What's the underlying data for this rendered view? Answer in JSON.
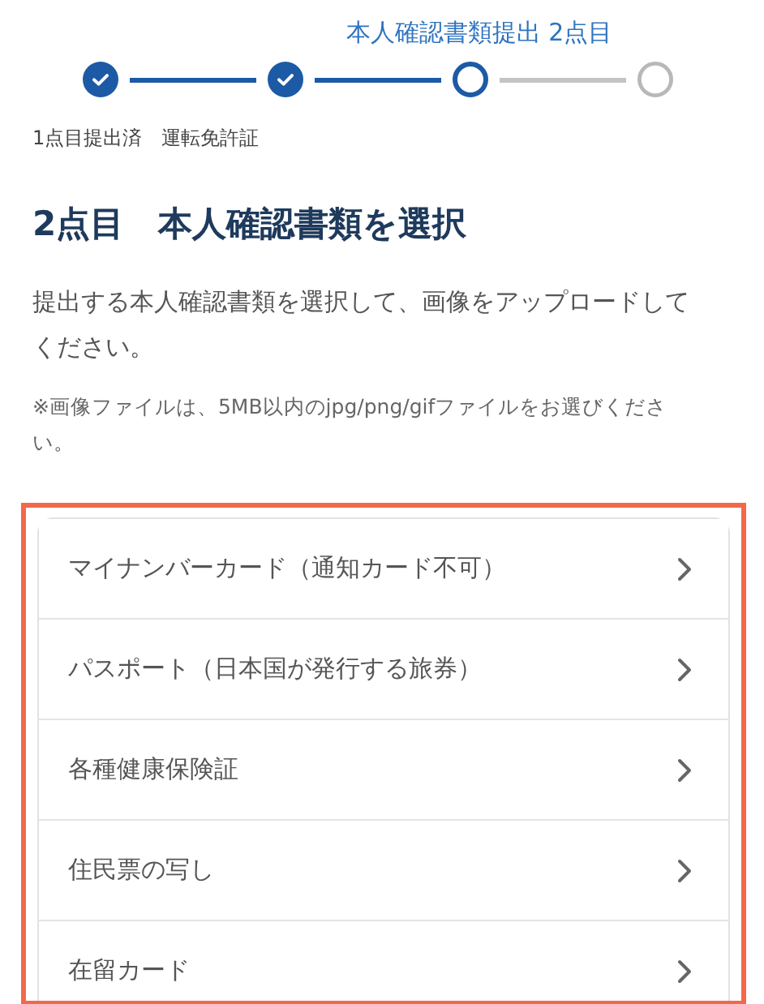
{
  "stepper": {
    "current_label": "本人確認書類提出 2点目",
    "steps": [
      {
        "kind": "done"
      },
      {
        "kind": "done"
      },
      {
        "kind": "current"
      },
      {
        "kind": "todo"
      }
    ]
  },
  "submitted_note": "1点目提出済　運転免許証",
  "heading": "2点目　本人確認書類を選択",
  "description": "提出する本人確認書類を選択して、画像をアップロードしてください。",
  "file_note": "※画像ファイルは、5MB以内のjpg/png/gifファイルをお選びください。",
  "document_list": {
    "highlighted": true,
    "items": [
      {
        "label": "マイナンバーカード（通知カード不可）"
      },
      {
        "label": "パスポート（日本国が発行する旅券）"
      },
      {
        "label": "各種健康保険証"
      },
      {
        "label": "住民票の写し"
      },
      {
        "label": "在留カード"
      }
    ]
  }
}
